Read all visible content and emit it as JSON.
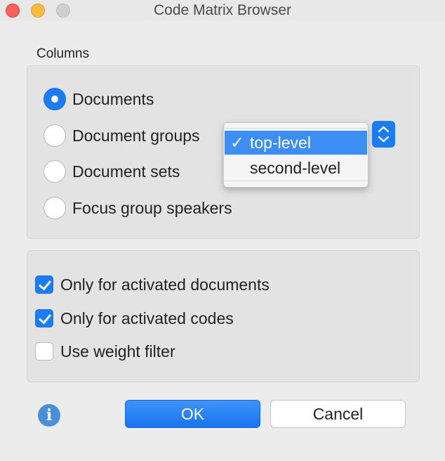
{
  "window": {
    "title": "Code Matrix Browser"
  },
  "columns": {
    "label": "Columns",
    "options": [
      {
        "label": "Documents",
        "selected": true
      },
      {
        "label": "Document groups",
        "selected": false
      },
      {
        "label": "Document sets",
        "selected": false
      },
      {
        "label": "Focus group speakers",
        "selected": false
      }
    ]
  },
  "level_dropdown": {
    "items": [
      {
        "label": "top-level",
        "checked": true,
        "check_mark": "✓"
      },
      {
        "label": "second-level",
        "checked": false,
        "check_mark": ""
      }
    ]
  },
  "filters": [
    {
      "label": "Only for activated documents",
      "checked": true
    },
    {
      "label": "Only for activated codes",
      "checked": true
    },
    {
      "label": "Use weight filter",
      "checked": false
    }
  ],
  "buttons": {
    "ok": "OK",
    "cancel": "Cancel"
  },
  "info_icon": {
    "glyph": "i"
  },
  "colors": {
    "accent": "#1b7cf5",
    "menu_highlight": "#3d8ef5"
  }
}
